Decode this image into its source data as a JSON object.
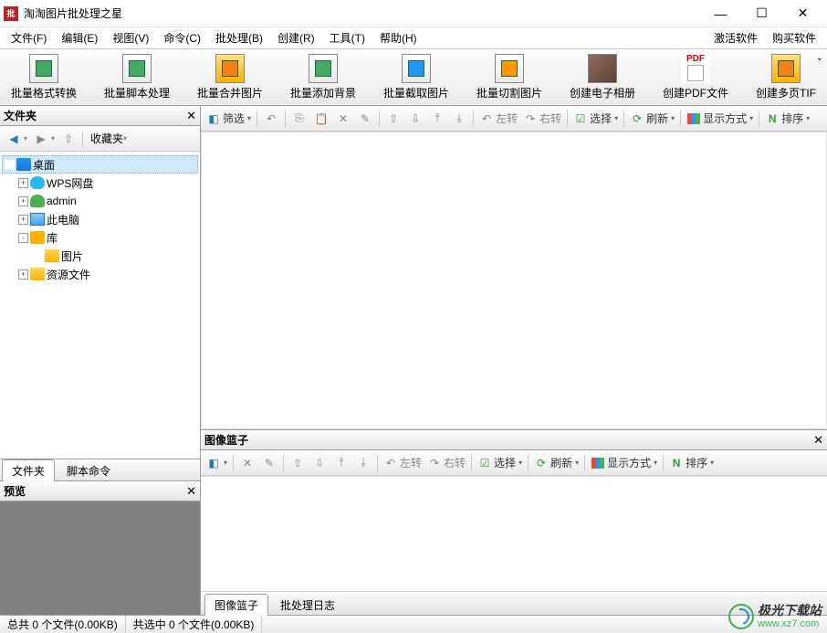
{
  "title": "淘淘图片批处理之星",
  "window": {
    "min": "—",
    "max": "☐",
    "close": "✕"
  },
  "menu": {
    "items": [
      "文件(F)",
      "编辑(E)",
      "视图(V)",
      "命令(C)",
      "批处理(B)",
      "创建(R)",
      "工具(T)",
      "帮助(H)"
    ],
    "right": [
      "激活软件",
      "购买软件"
    ]
  },
  "toolbar": {
    "items": [
      {
        "label": "批量格式转换",
        "name": "batch-format-convert"
      },
      {
        "label": "批量脚本处理",
        "name": "batch-script"
      },
      {
        "label": "批量合并图片",
        "name": "batch-merge"
      },
      {
        "label": "批量添加背景",
        "name": "batch-background"
      },
      {
        "label": "批量截取图片",
        "name": "batch-crop"
      },
      {
        "label": "批量切割图片",
        "name": "batch-split"
      },
      {
        "label": "创建电子相册",
        "name": "create-album"
      },
      {
        "label": "创建PDF文件",
        "name": "create-pdf"
      },
      {
        "label": "创建多页TIF",
        "name": "create-tif"
      }
    ]
  },
  "folder_panel": {
    "title": "文件夹",
    "favorites": "收藏夹",
    "tree": [
      {
        "label": "桌面",
        "icon": "ic-desktop",
        "depth": 0,
        "expander": "",
        "selected": true
      },
      {
        "label": "WPS网盘",
        "icon": "ic-cloud",
        "depth": 1,
        "expander": "+"
      },
      {
        "label": "admin",
        "icon": "ic-user",
        "depth": 1,
        "expander": "+"
      },
      {
        "label": "此电脑",
        "icon": "ic-pc",
        "depth": 1,
        "expander": "+"
      },
      {
        "label": "库",
        "icon": "ic-lib",
        "depth": 1,
        "expander": "-"
      },
      {
        "label": "图片",
        "icon": "ic-folder",
        "depth": 2,
        "expander": ""
      },
      {
        "label": "资源文件",
        "icon": "ic-folder",
        "depth": 1,
        "expander": "+"
      }
    ],
    "tabs": {
      "active": "文件夹",
      "inactive": "脚本命令"
    }
  },
  "preview": {
    "title": "预览"
  },
  "content_toolbar": {
    "filter": "筛选",
    "rotate_left": "左转",
    "rotate_right": "右转",
    "select": "选择",
    "refresh": "刷新",
    "view_mode": "显示方式",
    "sort": "排序"
  },
  "basket": {
    "title": "图像篮子",
    "tabs": {
      "active": "图像篮子",
      "inactive": "批处理日志"
    }
  },
  "status": {
    "total": "总共 0 个文件(0.00KB)",
    "selected": "共选中 0 个文件(0.00KB)"
  },
  "watermark": {
    "cn": "极光下载站",
    "url": "www.xz7.com"
  }
}
